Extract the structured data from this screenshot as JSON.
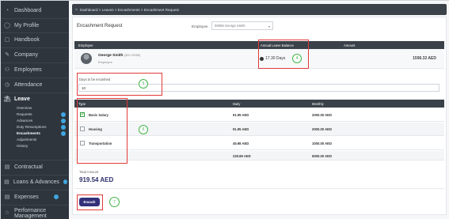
{
  "sidebar": {
    "items": [
      {
        "label": "Dashboard",
        "icon": "dashboard-icon",
        "glyph": "◔"
      },
      {
        "label": "My Profile",
        "icon": "user-icon",
        "glyph": "◯"
      },
      {
        "label": "Handbook",
        "icon": "book-icon",
        "glyph": "▢"
      },
      {
        "label": "Company",
        "icon": "company-icon",
        "glyph": "✎"
      },
      {
        "label": "Employees",
        "icon": "employees-icon",
        "glyph": "⚇"
      },
      {
        "label": "Attendance",
        "icon": "clock-icon",
        "glyph": "◷"
      },
      {
        "label": "Leave",
        "icon": "leave-icon",
        "glyph": "⛱"
      }
    ],
    "leave_sub": [
      {
        "label": "Overview",
        "badge": false
      },
      {
        "label": "Requests",
        "badge": true
      },
      {
        "label": "Advances",
        "badge": true
      },
      {
        "label": "Duty Resumptions",
        "badge": true
      },
      {
        "label": "Encashments",
        "badge": true
      },
      {
        "label": "Adjustments",
        "badge": false
      },
      {
        "label": "History",
        "badge": false
      }
    ],
    "bottom_items": [
      {
        "label": "Contractual",
        "icon": "contract-icon",
        "glyph": "▤"
      },
      {
        "label": "Loans & Advances",
        "icon": "loans-icon",
        "glyph": "▤"
      },
      {
        "label": "Expenses",
        "icon": "expenses-icon",
        "glyph": "▤"
      },
      {
        "label": "Performance Management",
        "icon": "performance-icon",
        "glyph": "☆"
      }
    ]
  },
  "breadcrumb": {
    "home_icon": "home-icon",
    "path": "Dashboard > Leaves > Encashments > Encashment Request"
  },
  "form": {
    "title": "Encashment Request",
    "employee_label": "Employee",
    "employee_value": "00058 George Smith",
    "employee_table": {
      "headers": [
        "Employee",
        "Annual Leave Balance",
        "Amount"
      ],
      "name": "George Smith",
      "name_suffix": "(300 00058)",
      "role": "Employee",
      "balance": "17.30 Days",
      "amount": "1596.32  AED"
    },
    "days_label": "Days to be encashed",
    "days_value": "10",
    "type_table": {
      "headers": [
        "Type",
        "Daily",
        "Monthly"
      ],
      "rows": [
        {
          "type": "Basic Salary",
          "checked": true,
          "daily": "91.95  AED",
          "monthly": "2000.00  AED"
        },
        {
          "type": "Housing",
          "checked": false,
          "daily": "91.95  AED",
          "monthly": "2000.00  AED"
        },
        {
          "type": "Transportation",
          "checked": false,
          "daily": "45.98  AED",
          "monthly": "1000.00  AED"
        }
      ],
      "totals": {
        "daily": "229.89  AED",
        "monthly": "5000.00  AED"
      }
    },
    "total_label": "Total Amount",
    "total_value": "919.54  AED",
    "encash_label": "Encash"
  },
  "markers": [
    "4",
    "5",
    "6",
    "7"
  ],
  "colors": {
    "sidebar": "#2e353d",
    "accent": "#33307a",
    "highlight": "#e23a3a",
    "marker": "#43b649"
  }
}
